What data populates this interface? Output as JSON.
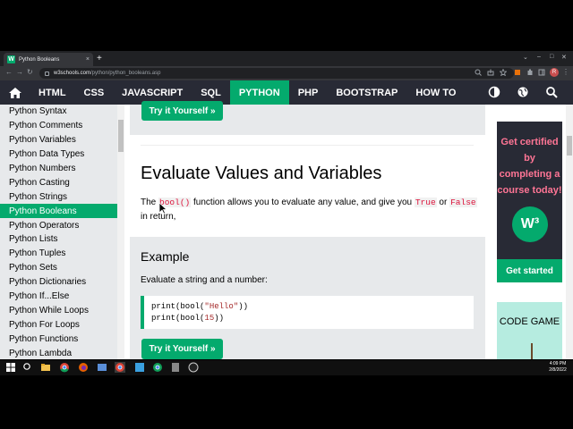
{
  "browser": {
    "tab_title": "Python Booleans",
    "tab_close": "×",
    "new_tab": "+",
    "url_host": "w3schools.com",
    "url_path": "/python/python_booleans.asp",
    "profile_initial": "R",
    "window_controls": [
      "⌄",
      "–",
      "□",
      "✕"
    ]
  },
  "site_nav": {
    "items": [
      "HTML",
      "CSS",
      "JAVASCRIPT",
      "SQL",
      "PYTHON",
      "PHP",
      "BOOTSTRAP",
      "HOW TO"
    ],
    "active": "PYTHON"
  },
  "sidebar": {
    "items": [
      "Python Syntax",
      "Python Comments",
      "Python Variables",
      "Python Data Types",
      "Python Numbers",
      "Python Casting",
      "Python Strings",
      "Python Booleans",
      "Python Operators",
      "Python Lists",
      "Python Tuples",
      "Python Sets",
      "Python Dictionaries",
      "Python If...Else",
      "Python While Loops",
      "Python For Loops",
      "Python Functions",
      "Python Lambda"
    ],
    "active": "Python Booleans"
  },
  "main": {
    "try_it_label": "Try it Yourself »",
    "heading": "Evaluate Values and Variables",
    "para_1": "The ",
    "para_code_1": "bool()",
    "para_2": " function allows you to evaluate any value, and give you ",
    "para_code_2": "True",
    "para_3": " or ",
    "para_code_3": "False",
    "para_4": " in return,",
    "example_heading": "Example",
    "example_desc": "Evaluate a string and a number:",
    "code_line_1_a": "print(bool(",
    "code_line_1_b": "\"Hello\"",
    "code_line_1_c": "))",
    "code_line_2_a": "print(bool(",
    "code_line_2_b": "15",
    "code_line_2_c": "))",
    "try_it_label_2": "Try it Yourself »"
  },
  "ad": {
    "text": "Get certified by completing a course today!",
    "logo": "W³",
    "button": "Get started",
    "code_game": "CODE GAME"
  },
  "taskbar": {
    "time": "4:09 PM",
    "date": "2/8/2022"
  },
  "colors": {
    "accent": "#04aa6d",
    "nav_bg": "#282a35",
    "sidebar_bg": "#e7e9eb",
    "ad_text": "#ff7595"
  }
}
